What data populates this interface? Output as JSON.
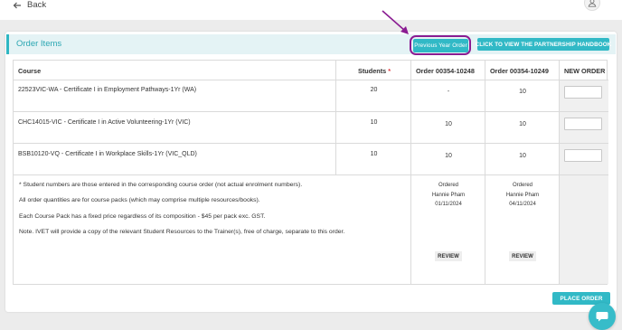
{
  "topbar": {
    "back_label": "Back"
  },
  "section": {
    "title": "Order Items"
  },
  "buttons": {
    "previous_year": "Previous Year Order",
    "handbook": "CLICK TO VIEW THE PARTNERSHIP HANDBOOK",
    "place_order": "PLACE ORDER",
    "review": "REVIEW"
  },
  "table": {
    "headers": {
      "course": "Course",
      "students": "Students",
      "students_marker": "*",
      "order1": "Order 00354-10248",
      "order2": "Order 00354-10249",
      "new_order": "NEW ORDER"
    },
    "rows": [
      {
        "course": "22523VIC-WA - Certificate I in Employment Pathways-1Yr (WA)",
        "students": "20",
        "order1": "-",
        "order2": "10"
      },
      {
        "course": "CHC14015-VIC - Certificate I in Active Volunteering-1Yr (VIC)",
        "students": "10",
        "order1": "10",
        "order2": "10"
      },
      {
        "course": "BSB10120-VQ - Certificate I in Workplace Skills-1Yr (VIC_QLD)",
        "students": "10",
        "order1": "10",
        "order2": "10"
      }
    ],
    "notes": [
      "* Student numbers are those entered in the corresponding course order (not actual enrolment numbers).",
      "All order quantities are for course packs (which may comprise multiple resources/books).",
      "Each Course Pack has a fixed price regardless of its composition - $45 per pack exc. GST.",
      "Note. IVET will provide a copy of the relevant Student Resources to the Trainer(s), free of charge, separate to this order."
    ],
    "order_status": [
      {
        "status": "Ordered",
        "by": "Hannie Pham",
        "date": "01/11/2024"
      },
      {
        "status": "Ordered",
        "by": "Hannie Pham",
        "date": "04/11/2024"
      }
    ]
  },
  "colors": {
    "teal": "#31b9c6",
    "highlight": "#8a1c92",
    "required": "#e0393e"
  },
  "icons": {
    "back": "arrow-left-icon",
    "user": "user-icon",
    "chat": "chat-icon"
  }
}
